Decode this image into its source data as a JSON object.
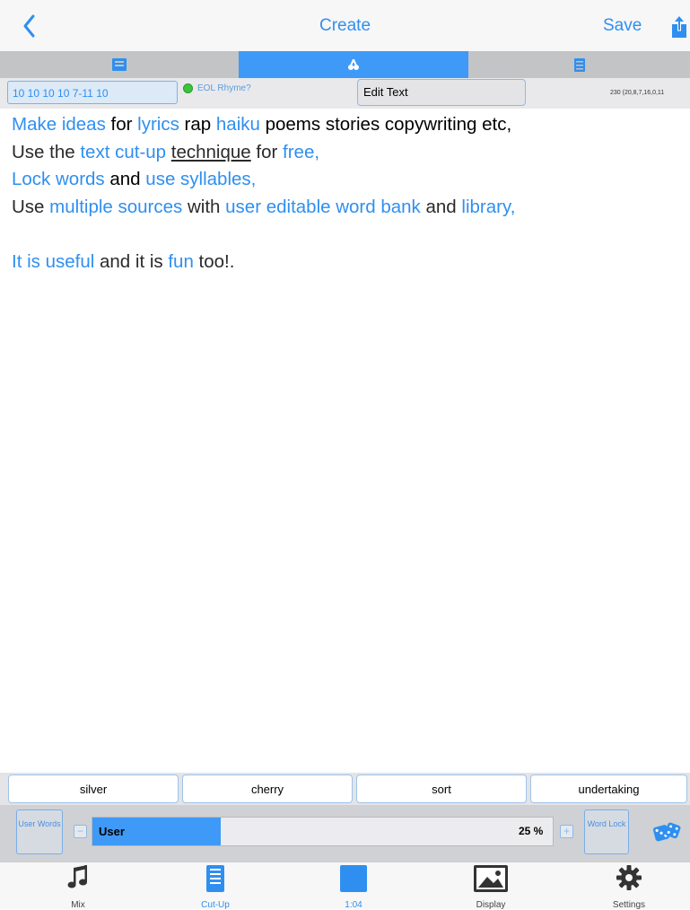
{
  "nav": {
    "title": "Create",
    "save_label": "Save"
  },
  "segments": [
    {
      "icon": "card-icon",
      "selected": false
    },
    {
      "icon": "scissors-icon",
      "selected": true
    },
    {
      "icon": "list-icon",
      "selected": false
    }
  ],
  "info": {
    "syllable_pattern": "10 10 10 10 7-11 10",
    "eol_rhyme_label": "EOL Rhyme?",
    "edit_text_label": "Edit Text",
    "counts": "230 (20,8,7,16,0,11"
  },
  "text_lines": [
    [
      "Make ideas",
      " for ",
      "lyrics",
      " rap ",
      "haiku",
      " poems stories copywriting etc,"
    ],
    [
      "Use the ",
      "text cut-up",
      " ",
      "technique",
      " for ",
      "free,"
    ],
    [
      "Lock words",
      " and ",
      "use syllables,"
    ],
    [
      "Use ",
      "multiple sources",
      " with ",
      "user editable word bank",
      " and ",
      "library,"
    ],
    [
      "It is useful",
      " and it is ",
      "fun",
      " too!."
    ]
  ],
  "word_bank": [
    "silver",
    "cherry",
    "sort",
    "undertaking"
  ],
  "controls": {
    "user_words_label": "User Words",
    "slider_label": "User",
    "slider_percent_text": "25 %",
    "slider_fraction": 0.25,
    "word_lock_label": "Word Lock"
  },
  "tabs": [
    {
      "label": "Mix",
      "icon": "music-note-icon"
    },
    {
      "label": "Cut-Up",
      "icon": "document-icon",
      "selected": true
    },
    {
      "label": "1:04",
      "icon": "square-icon"
    },
    {
      "label": "Display",
      "icon": "image-icon"
    },
    {
      "label": "Settings",
      "icon": "gear-icon"
    }
  ],
  "colors": {
    "accent": "#2f8ff0",
    "selected_segment": "#3e9af6"
  }
}
